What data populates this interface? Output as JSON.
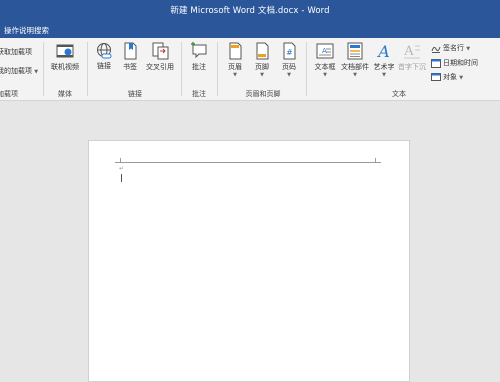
{
  "window": {
    "title": "新建 Microsoft Word 文档.docx  -  Word"
  },
  "tell_me": {
    "label": "操作说明搜索"
  },
  "ribbon": {
    "left_items": [
      "获取加载项",
      "我的加载项",
      "加载项"
    ],
    "media": {
      "online_video": "联机视频",
      "group": "媒体"
    },
    "links": {
      "link": "链接",
      "bookmark": "书签",
      "cross_ref": "交叉引用",
      "group": "链接"
    },
    "comments": {
      "comment": "批注",
      "group": "批注"
    },
    "header_footer": {
      "header": "页眉",
      "footer": "页脚",
      "page_number": "页码",
      "group": "页眉和页脚"
    },
    "text": {
      "textbox": "文本框",
      "quick_parts": "文档部件",
      "wordart": "艺术字",
      "drop_cap": "首字下沉",
      "signature_line": "签名行",
      "date_time": "日期和时间",
      "object": "对象",
      "group": "文本"
    }
  }
}
